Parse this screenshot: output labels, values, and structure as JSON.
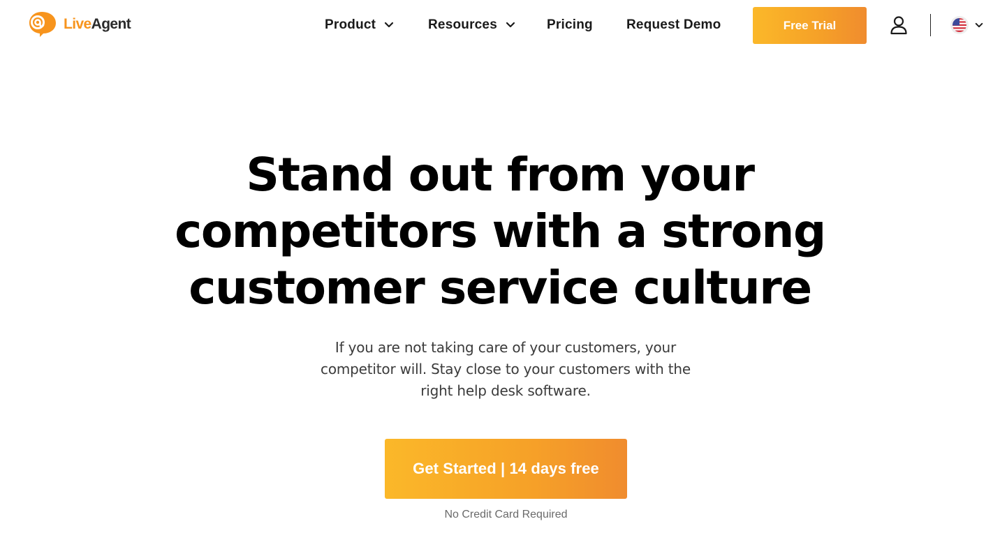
{
  "brand": {
    "logo_part1": "Live",
    "logo_part2": "Agent",
    "accent_color": "#f7941d",
    "icon": "liveagent-logo-icon"
  },
  "nav": {
    "items": [
      {
        "label": "Product",
        "has_dropdown": true
      },
      {
        "label": "Resources",
        "has_dropdown": true
      },
      {
        "label": "Pricing",
        "has_dropdown": false
      },
      {
        "label": "Request Demo",
        "has_dropdown": false
      }
    ],
    "free_trial_label": "Free Trial",
    "user_icon": "user-icon",
    "language_icon": "us-flag-icon",
    "language_dropdown_icon": "chevron-down-icon"
  },
  "hero": {
    "title_lines": [
      "Stand out from your",
      "competitors with a strong",
      "customer service culture"
    ],
    "subtitle_lines": [
      "If you are not taking care of your customers, your",
      "competitor will. Stay close to your customers with the",
      "right help desk software."
    ],
    "cta_label": "Get Started | 14 days free",
    "cta_note": "No Credit Card Required"
  },
  "colors": {
    "button_gradient_start": "#fbb829",
    "button_gradient_end": "#f08c2e",
    "text_dark": "#000000",
    "text_muted": "#6a6a6a"
  }
}
